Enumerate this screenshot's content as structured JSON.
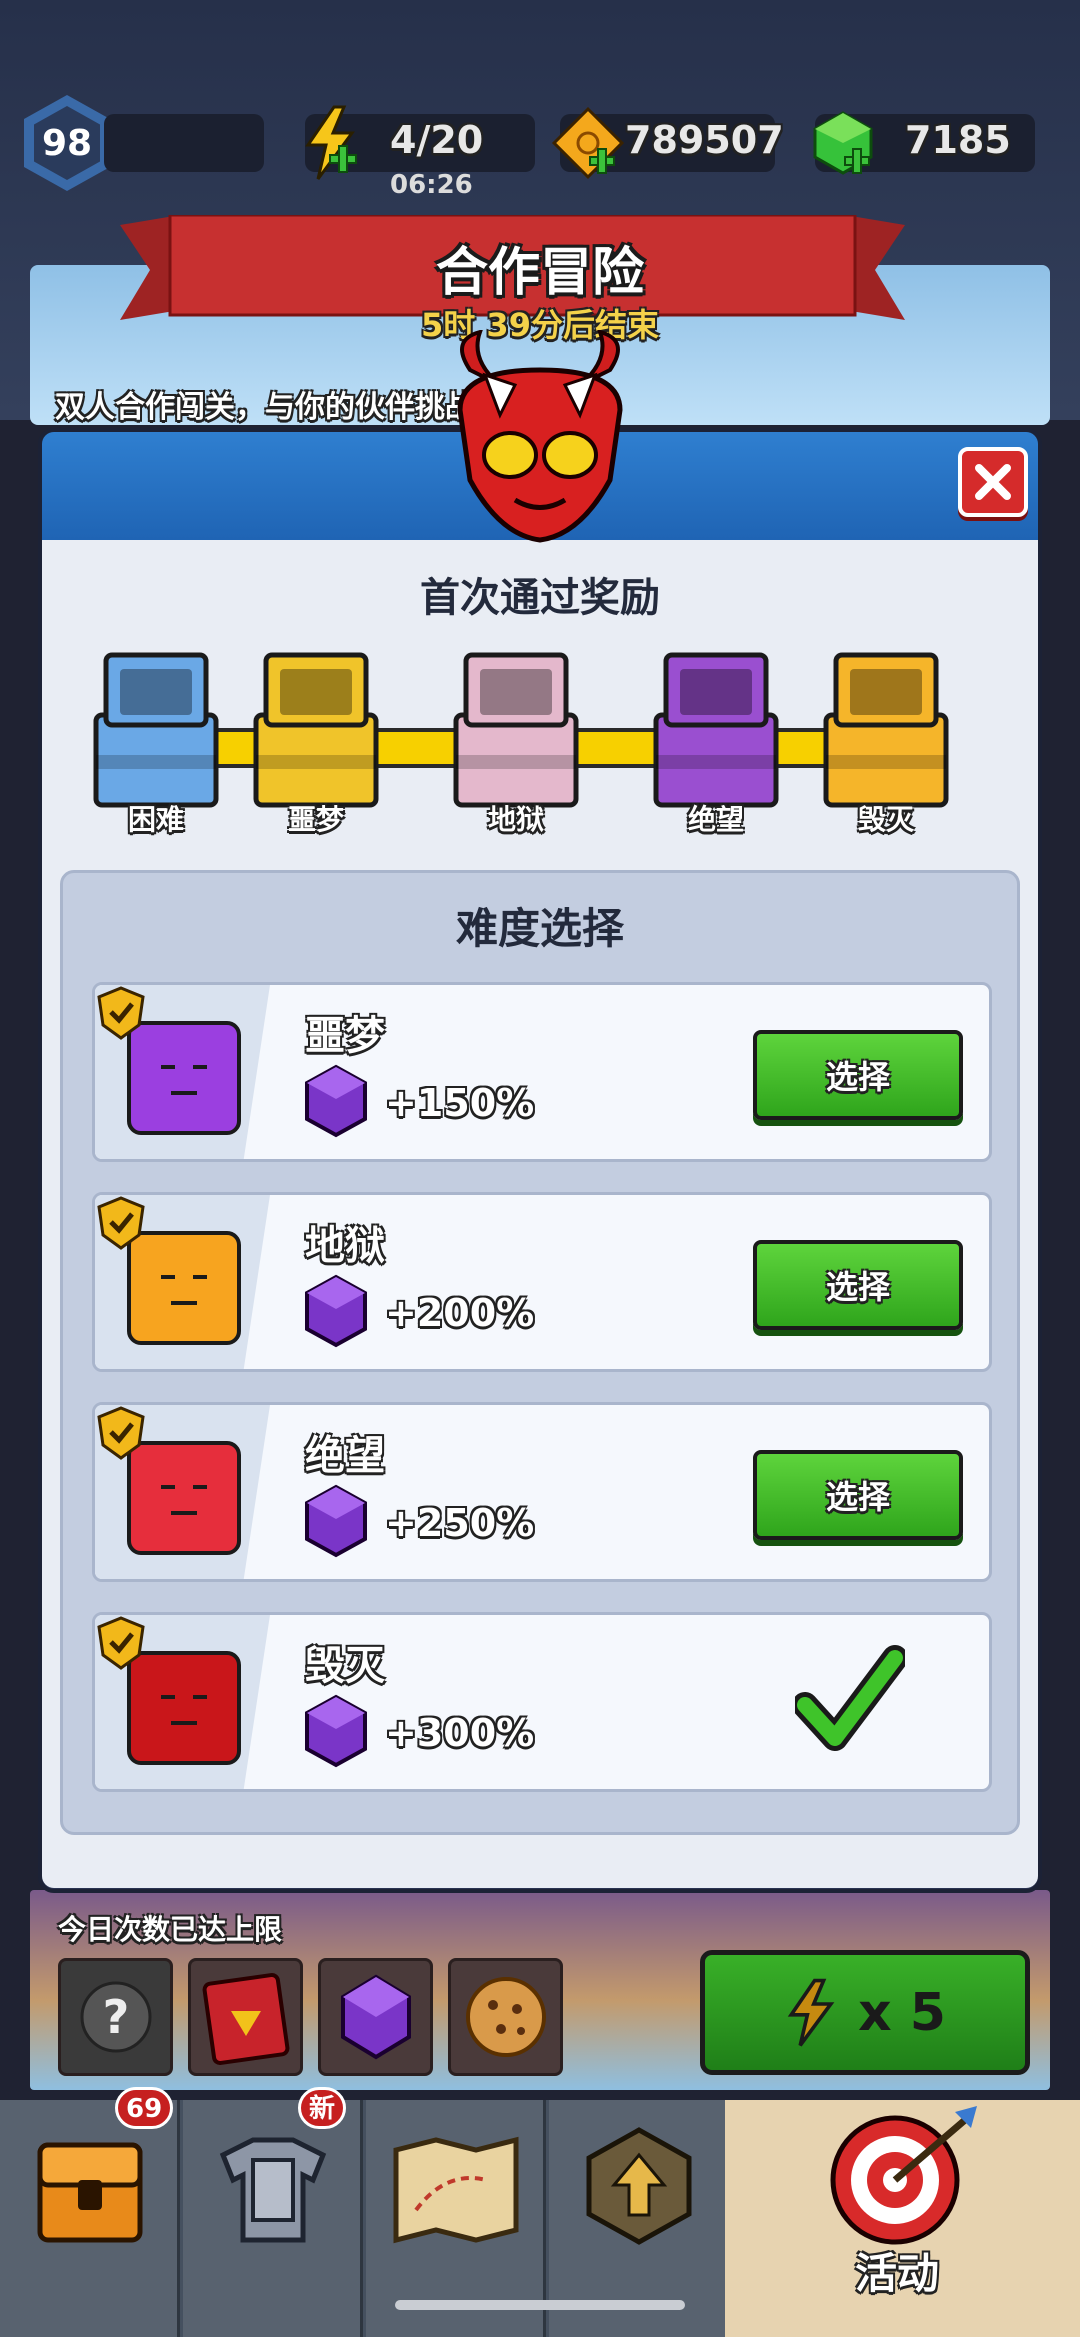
{
  "top_bar": {
    "level": "98",
    "energy": "4/20",
    "energy_timer": "06:26",
    "coins": "789507",
    "gems": "7185"
  },
  "event": {
    "title": "合作冒险",
    "timer": "5时 39分后结束",
    "description": "双人合作闯关，与你的伙伴挑战更高难度！"
  },
  "modal": {
    "reward_title": "首次通过奖励",
    "chests": [
      {
        "label": "困难",
        "color": "#6aa8e6"
      },
      {
        "label": "噩梦",
        "color": "#f0c42a"
      },
      {
        "label": "地狱",
        "color": "#e4b8cc"
      },
      {
        "label": "绝望",
        "color": "#9a4fd0"
      },
      {
        "label": "毁灭",
        "color": "#f5b52a"
      }
    ],
    "difficulty_title": "难度选择",
    "rows": [
      {
        "name": "噩梦",
        "bonus": "+150%",
        "button": "选择",
        "face_color": "#9b3fe0",
        "selected": false
      },
      {
        "name": "地狱",
        "bonus": "+200%",
        "button": "选择",
        "face_color": "#f7a41f",
        "selected": false
      },
      {
        "name": "绝望",
        "bonus": "+250%",
        "button": "选择",
        "face_color": "#e62e3c",
        "selected": false
      },
      {
        "name": "毁灭",
        "bonus": "+300%",
        "button": "",
        "face_color": "#c9161a",
        "selected": true
      }
    ]
  },
  "bottom": {
    "limit_text": "今日次数已达上限",
    "start_cost": "x 5"
  },
  "nav": {
    "chest_badge": "69",
    "armor_badge": "新",
    "active_label": "活动"
  }
}
